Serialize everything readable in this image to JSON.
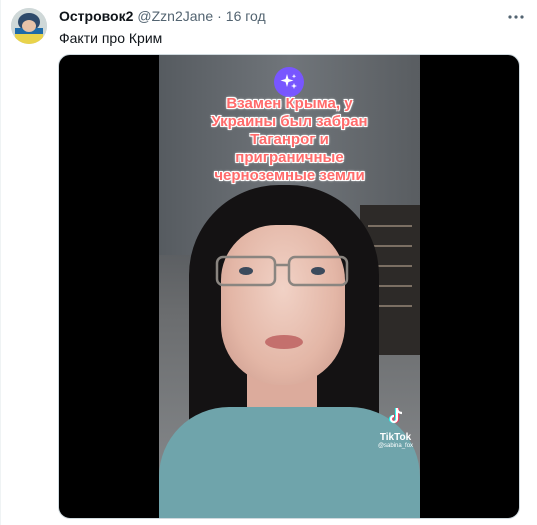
{
  "tweet": {
    "display_name": "Островок2",
    "handle": "@Zzn2Jane",
    "separator": "·",
    "time": "16 год",
    "text": "Факти про Крим",
    "more_icon": "more-icon"
  },
  "video": {
    "caption_lines": [
      "Взамен Крыма, у",
      "Украины был забран",
      "Таганрог и",
      "приграничные",
      "черноземные земли"
    ],
    "badge_icon": "sparkles-icon",
    "watermark": {
      "logo_text": "TikTok",
      "username": "@sabina_fox"
    }
  },
  "colors": {
    "caption": "#ff6b6b",
    "badge": "#7856ff",
    "secondary_text": "#536471"
  }
}
